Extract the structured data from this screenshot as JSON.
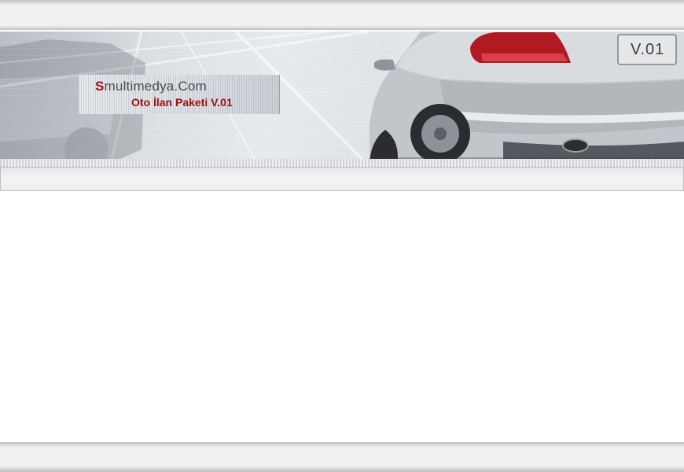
{
  "header": {
    "logo": {
      "initial": "S",
      "site_name_rest": "multimedya.Com",
      "tagline": "Oto İlan Paketi V.01"
    },
    "plate_text": "V.01"
  },
  "colors": {
    "brand_red": "#9b1111",
    "text_gray": "#4d4d4d",
    "bar_gray": "#f1f1f1"
  }
}
